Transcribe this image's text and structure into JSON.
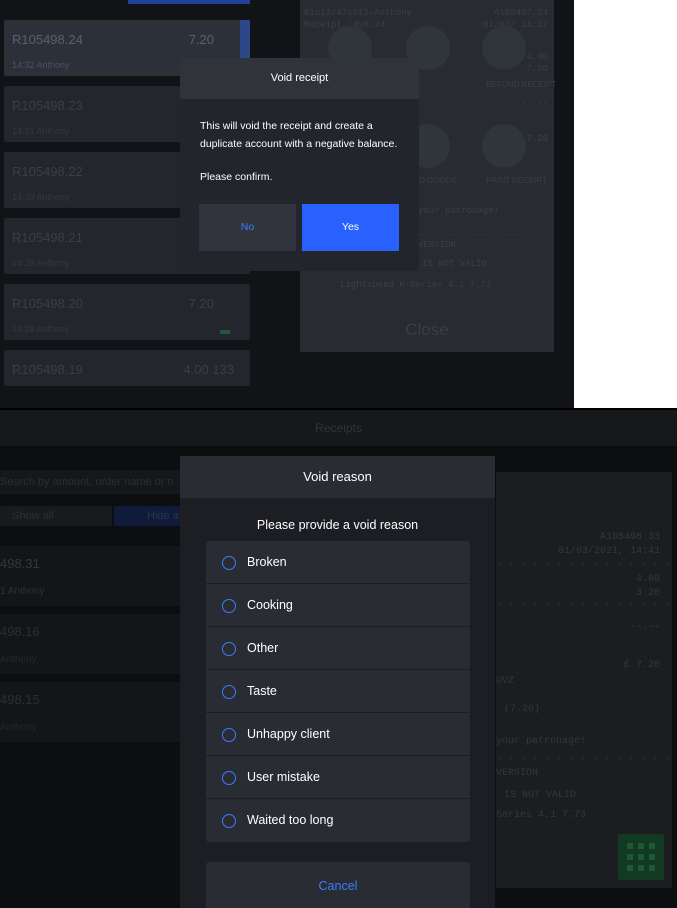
{
  "top": {
    "receipts": [
      {
        "id": "R105498.24",
        "amount": "7.20",
        "meta": "14:32   Anthony",
        "selected": true
      },
      {
        "id": "R105498.23",
        "amount": "",
        "meta": "14:31   Anthony",
        "selected": false
      },
      {
        "id": "R105498.22",
        "amount": "",
        "meta": "14:30   Anthony",
        "selected": false
      },
      {
        "id": "R105498.21",
        "amount": "",
        "meta": "14:29   Anthony",
        "selected": false
      },
      {
        "id": "R105498.20",
        "amount": "7.20",
        "meta": "14:28   Anthony",
        "selected": false
      },
      {
        "id": "R105498.19",
        "amount": "4.00 133",
        "meta": "",
        "selected": false
      }
    ],
    "receipt": {
      "line1_left": "Bin12/471512-Anthony",
      "line1_right": "A105497.24",
      "line2_left": "Receipt  '498.24",
      "line2_right": "01/03/  14:32",
      "amount1": "4.00",
      "amount2": "7.20",
      "dashes": "-- .--",
      "total": "7.20",
      "labels": [
        "REFUND RECEIPT",
        "ADD GOODS",
        "PRINT RECEIPT"
      ],
      "patronage": "your patronage!",
      "version": "VERSION",
      "not_valid": "IS NOT VALID",
      "footer": "Lightspeed K-Series 4.1 7.73",
      "close_label": "Close"
    },
    "dialog": {
      "title": "Void receipt",
      "message": "This will void the receipt and create a duplicate account with a negative balance.",
      "confirm": "Please confirm.",
      "no_label": "No",
      "yes_label": "Yes"
    }
  },
  "bottom": {
    "title": "Receipts",
    "search_placeholder": "Search by amount, order name or n",
    "show_all": "Show all",
    "hide_label": "Hide a",
    "rows": [
      {
        "id": "498.31",
        "meta": "1   Anthony"
      },
      {
        "id": "498.16",
        "meta": "   Anthony"
      },
      {
        "id": "498.15",
        "meta": "   Anthony"
      }
    ],
    "receipt": {
      "id": "A105498.33",
      "datetime": "01/03/2021, 14:41",
      "amount1": "4.00",
      "amount2": "3.20",
      "dashes": "--.--",
      "total": "£ 7.20",
      "code": "UVZ",
      "paren": "(7.20)",
      "patronage": "your patronage!",
      "version": "VERSION",
      "not_valid": "IS NOT VALID",
      "series": "Series 4.1 7.73"
    },
    "dialog": {
      "title": "Void reason",
      "prompt": "Please provide a void reason",
      "options": [
        "Broken",
        "Cooking",
        "Other",
        "Taste",
        "Unhappy client",
        "User mistake",
        "Waited too long"
      ],
      "cancel_label": "Cancel"
    }
  },
  "colors": {
    "accent": "#2961ff",
    "link": "#3f7bff",
    "dialog_bg": "#22252b"
  }
}
